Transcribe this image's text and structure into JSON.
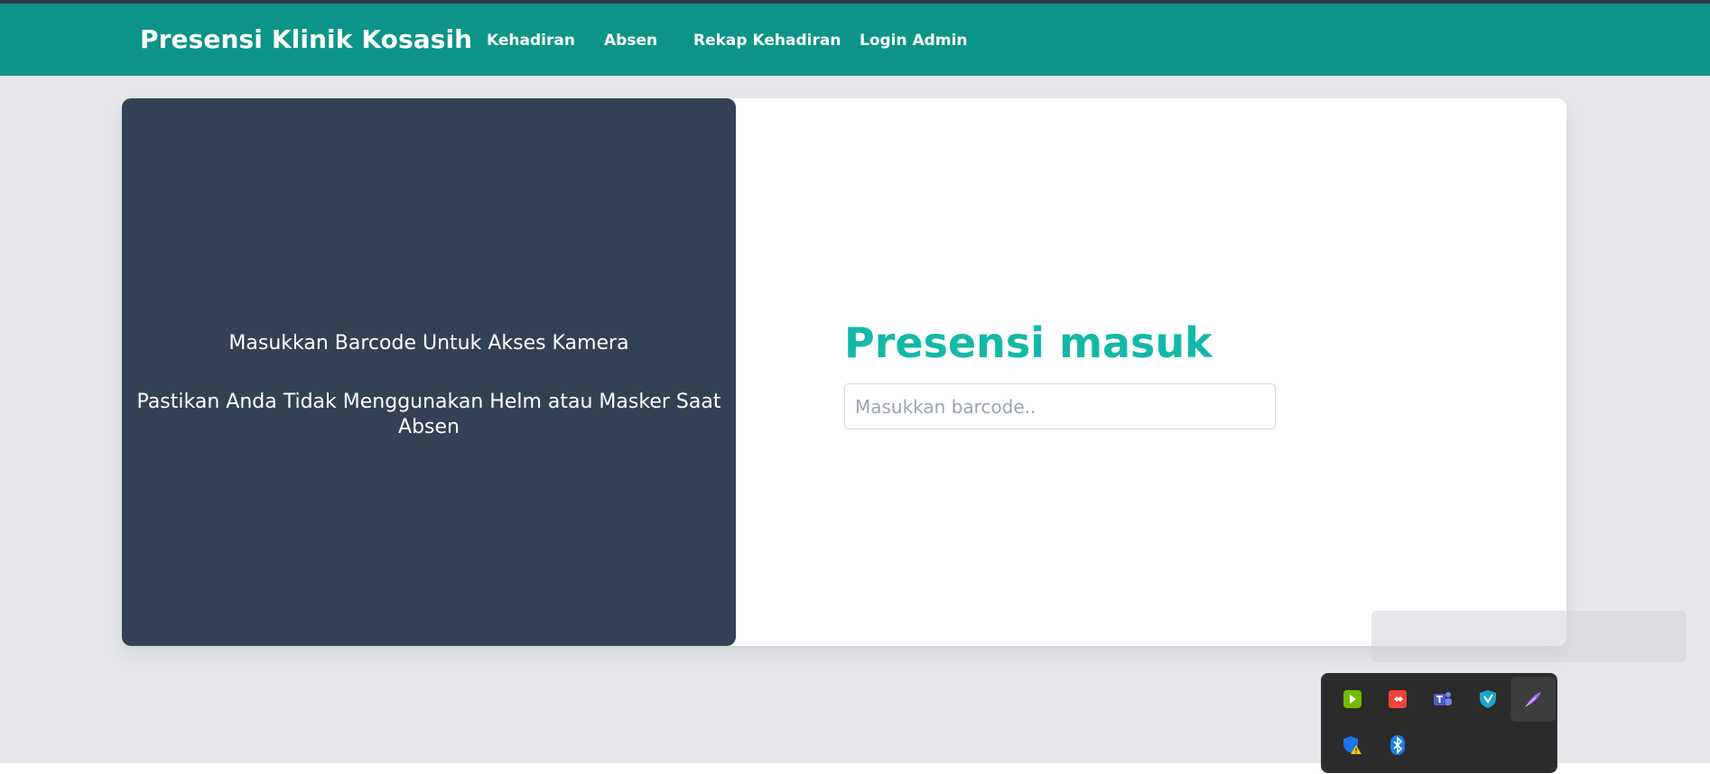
{
  "navbar": {
    "brand": "Presensi Klinik Kosasih",
    "links": [
      {
        "label": "Kehadiran"
      },
      {
        "label": "Absen"
      },
      {
        "label": "Rekap Kehadiran"
      },
      {
        "label": "Login Admin"
      }
    ],
    "color": "#0d9488"
  },
  "left_panel": {
    "line1": "Masukkan Barcode Untuk Akses Kamera",
    "line2": "Pastikan Anda Tidak Menggunakan Helm atau Masker Saat Absen",
    "color": "#334155"
  },
  "form": {
    "title": "Presensi masuk",
    "title_color": "#14b8a6",
    "barcode_value": "",
    "barcode_placeholder": "Masukkan barcode.."
  },
  "tray": {
    "icons": [
      "nvidia-icon",
      "anydesk-icon",
      "teams-icon",
      "vpn-shield-icon",
      "pen-feather-icon",
      "security-warning-icon",
      "bluetooth-icon"
    ]
  }
}
